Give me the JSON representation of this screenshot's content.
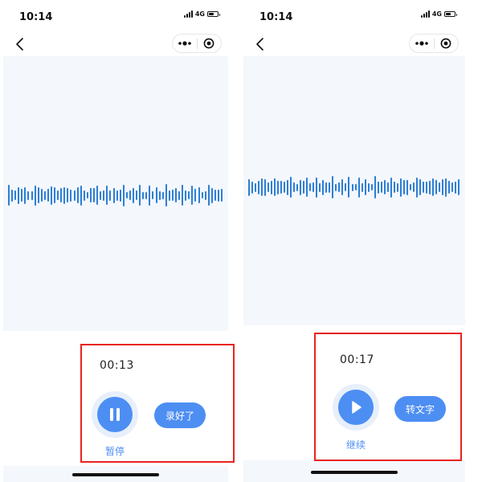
{
  "screens": [
    {
      "id": "left",
      "status_bar": {
        "time": "10:14",
        "network": "4G"
      },
      "timer": "00:13",
      "main_button": {
        "icon": "pause-icon",
        "label": "暂停"
      },
      "action_button": {
        "label": "录好了"
      }
    },
    {
      "id": "right",
      "status_bar": {
        "time": "10:14",
        "network": "4G"
      },
      "timer": "00:17",
      "main_button": {
        "icon": "play-icon",
        "label": "继续"
      },
      "action_button": {
        "label": "转文字"
      }
    }
  ],
  "colors": {
    "accent": "#4d8ef3",
    "waveform": "#2f7fd3",
    "wave_background": "#f4f7fc",
    "highlight": "#e8231f"
  },
  "icons": [
    "back-chevron-icon",
    "more-dots-icon",
    "close-target-icon",
    "pause-icon",
    "play-icon",
    "signal-icon",
    "battery-icon"
  ]
}
